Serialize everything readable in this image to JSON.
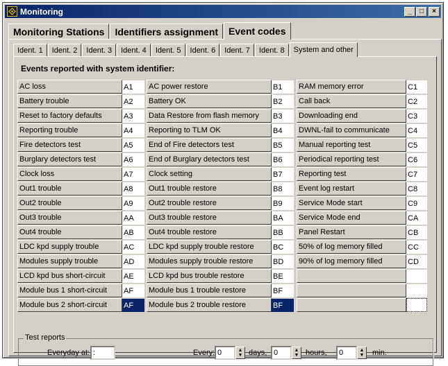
{
  "window": {
    "title": "Monitoring",
    "buttons": {
      "minimize": "_",
      "maximize": "□",
      "close": "×"
    }
  },
  "main_tabs": [
    {
      "label": "Monitoring Stations"
    },
    {
      "label": "Identifiers assignment"
    },
    {
      "label": "Event codes",
      "active": true
    }
  ],
  "sub_tabs": [
    {
      "label": "Ident. 1"
    },
    {
      "label": "Ident. 2"
    },
    {
      "label": "Ident. 3"
    },
    {
      "label": "Ident. 4"
    },
    {
      "label": "Ident. 5"
    },
    {
      "label": "Ident. 6"
    },
    {
      "label": "Ident. 7"
    },
    {
      "label": "Ident. 8"
    },
    {
      "label": "System and other",
      "active": true
    }
  ],
  "section_title": "Events reported with system identifier:",
  "columns": [
    {
      "rows": [
        {
          "event": "AC loss",
          "code": "A1"
        },
        {
          "event": "Battery trouble",
          "code": "A2"
        },
        {
          "event": "Reset to factory defaults",
          "code": "A3"
        },
        {
          "event": "Reporting trouble",
          "code": "A4"
        },
        {
          "event": "Fire detectors test",
          "code": "A5"
        },
        {
          "event": "Burglary detectors test",
          "code": "A6"
        },
        {
          "event": "Clock loss",
          "code": "A7"
        },
        {
          "event": "Out1 trouble",
          "code": "A8"
        },
        {
          "event": "Out2 trouble",
          "code": "A9"
        },
        {
          "event": "Out3 trouble",
          "code": "AA"
        },
        {
          "event": "Out4 trouble",
          "code": "AB"
        },
        {
          "event": "LDC kpd supply trouble",
          "code": "AC"
        },
        {
          "event": "Modules supply trouble",
          "code": "AD"
        },
        {
          "event": "LCD kpd bus short-circuit",
          "code": "AE"
        },
        {
          "event": "Module bus 1 short-circuit",
          "code": "AF"
        },
        {
          "event": "Module bus 2 short-circuit",
          "code": "AF",
          "selected": true
        }
      ]
    },
    {
      "rows": [
        {
          "event": "AC power restore",
          "code": "B1"
        },
        {
          "event": "Battery OK",
          "code": "B2"
        },
        {
          "event": "Data Restore from flash memory",
          "code": "B3"
        },
        {
          "event": "Reporting to TLM OK",
          "code": "B4"
        },
        {
          "event": "End of Fire detectors test",
          "code": "B5"
        },
        {
          "event": "End of Burglary detectors test",
          "code": "B6"
        },
        {
          "event": "Clock setting",
          "code": "B7"
        },
        {
          "event": "Out1 trouble restore",
          "code": "B8"
        },
        {
          "event": "Out2 trouble restore",
          "code": "B9"
        },
        {
          "event": "Out3 trouble restore",
          "code": "BA"
        },
        {
          "event": "Out4 trouble restore",
          "code": "BB"
        },
        {
          "event": "LDC kpd supply trouble restore",
          "code": "BC"
        },
        {
          "event": "Modules supply trouble restore",
          "code": "BD"
        },
        {
          "event": "LCD kpd bus trouble restore",
          "code": "BE"
        },
        {
          "event": "Module bus 1 trouble restore",
          "code": "BF"
        },
        {
          "event": "Module bus 2 trouble restore",
          "code": "BF",
          "selected": true
        }
      ]
    },
    {
      "rows": [
        {
          "event": "RAM memory error",
          "code": "C1"
        },
        {
          "event": "Call back",
          "code": "C2"
        },
        {
          "event": "Downloading end",
          "code": "C3"
        },
        {
          "event": "DWNL-fail to communicate",
          "code": "C4"
        },
        {
          "event": "Manual reporting test",
          "code": "C5"
        },
        {
          "event": "Periodical reporting test",
          "code": "C6"
        },
        {
          "event": "Reporting test",
          "code": "C7"
        },
        {
          "event": "Event log restart",
          "code": "C8"
        },
        {
          "event": "Service Mode start",
          "code": "C9"
        },
        {
          "event": "Service Mode end",
          "code": "CA"
        },
        {
          "event": "Panel Restart",
          "code": "CB"
        },
        {
          "event": "50% of log memory filled",
          "code": "CC"
        },
        {
          "event": "90% of log memory filled",
          "code": "CD"
        },
        {
          "event": "",
          "code": ""
        },
        {
          "event": "",
          "code": ""
        },
        {
          "event": "",
          "code": "",
          "focused": true
        }
      ]
    }
  ],
  "test_reports": {
    "legend": "Test reports",
    "everyday_label": "Everyday at:",
    "everyday_value": " :",
    "every_label": "Every:",
    "days_value": "0",
    "days_label": "days,",
    "hours_value": "0",
    "hours_label": "hours,",
    "min_value": "0",
    "min_label": "min."
  }
}
